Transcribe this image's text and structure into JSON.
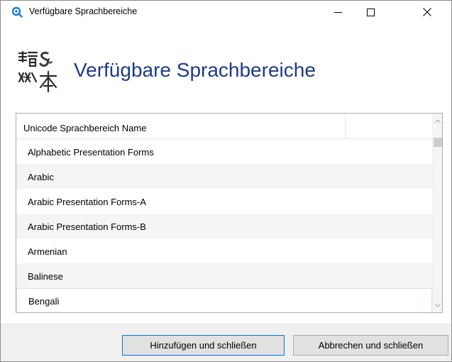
{
  "window": {
    "title": "Verfügbare Sprachbereiche",
    "controls": {
      "minimize_icon": "minimize-icon",
      "maximize_icon": "maximize-icon",
      "close_icon": "close-icon"
    }
  },
  "header": {
    "title": "Verfügbare Sprachbereiche",
    "logo_icon": "language-logo-icon",
    "title_color": "#1e3c83"
  },
  "list": {
    "columns": [
      "Unicode Sprachbereich Name",
      ""
    ],
    "rows": [
      "Alphabetic Presentation Forms",
      "Arabic",
      "Arabic Presentation Forms-A",
      "Arabic Presentation Forms-B",
      "Armenian",
      "Balinese",
      "Bengali"
    ],
    "selected_row": "Bengali",
    "scroll_up_icon": "chevron-up-icon",
    "scroll_down_icon": "chevron-down-icon"
  },
  "footer": {
    "add_button": "Hinzufügen und schließen",
    "cancel_button": "Abbrechen und schließen",
    "accent_color": "#0078d7"
  }
}
